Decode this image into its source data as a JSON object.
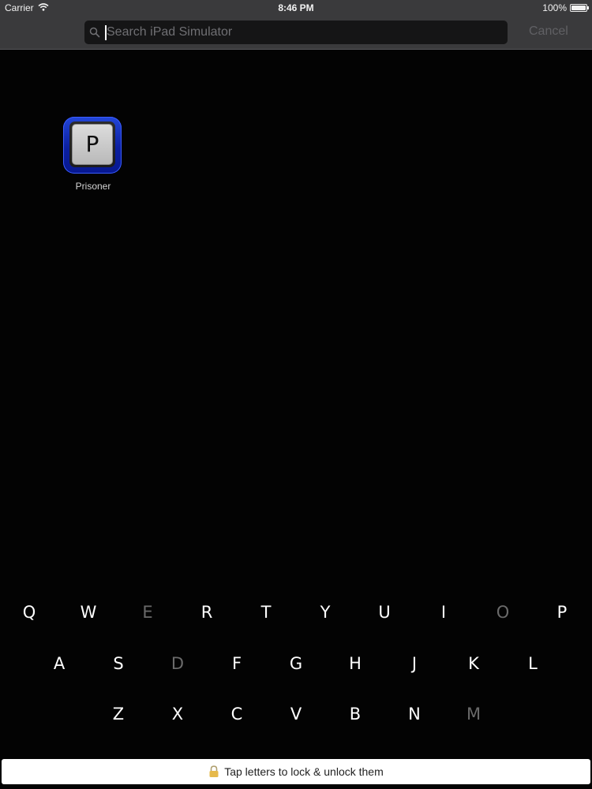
{
  "status_bar": {
    "carrier": "Carrier",
    "time": "8:46 PM",
    "battery": "100%",
    "wifi_icon": "wifi-icon",
    "battery_icon": "battery-icon"
  },
  "search": {
    "placeholder": "Search iPad Simulator",
    "value": "",
    "icon": "search-icon",
    "cancel_label": "Cancel"
  },
  "app": {
    "name": "Prisoner",
    "icon_letter": "P",
    "icon_colors": {
      "frame": "#1a34c8",
      "tile": "#c8c8c8"
    }
  },
  "keyboard": {
    "rows": [
      [
        {
          "letter": "Q",
          "locked": false
        },
        {
          "letter": "W",
          "locked": false
        },
        {
          "letter": "E",
          "locked": true
        },
        {
          "letter": "R",
          "locked": false
        },
        {
          "letter": "T",
          "locked": false
        },
        {
          "letter": "Y",
          "locked": false
        },
        {
          "letter": "U",
          "locked": false
        },
        {
          "letter": "I",
          "locked": false
        },
        {
          "letter": "O",
          "locked": true
        },
        {
          "letter": "P",
          "locked": false
        }
      ],
      [
        {
          "letter": "A",
          "locked": false
        },
        {
          "letter": "S",
          "locked": false
        },
        {
          "letter": "D",
          "locked": true
        },
        {
          "letter": "F",
          "locked": false
        },
        {
          "letter": "G",
          "locked": false
        },
        {
          "letter": "H",
          "locked": false
        },
        {
          "letter": "J",
          "locked": false
        },
        {
          "letter": "K",
          "locked": false
        },
        {
          "letter": "L",
          "locked": false
        }
      ],
      [
        {
          "letter": "Z",
          "locked": false
        },
        {
          "letter": "X",
          "locked": false
        },
        {
          "letter": "C",
          "locked": false
        },
        {
          "letter": "V",
          "locked": false
        },
        {
          "letter": "B",
          "locked": false
        },
        {
          "letter": "N",
          "locked": false
        },
        {
          "letter": "M",
          "locked": true
        }
      ]
    ],
    "colors": {
      "unlocked": "#ffffff",
      "locked": "#6a6a6a"
    }
  },
  "footer": {
    "text": "Tap letters to lock & unlock them",
    "icon": "lock-icon"
  }
}
